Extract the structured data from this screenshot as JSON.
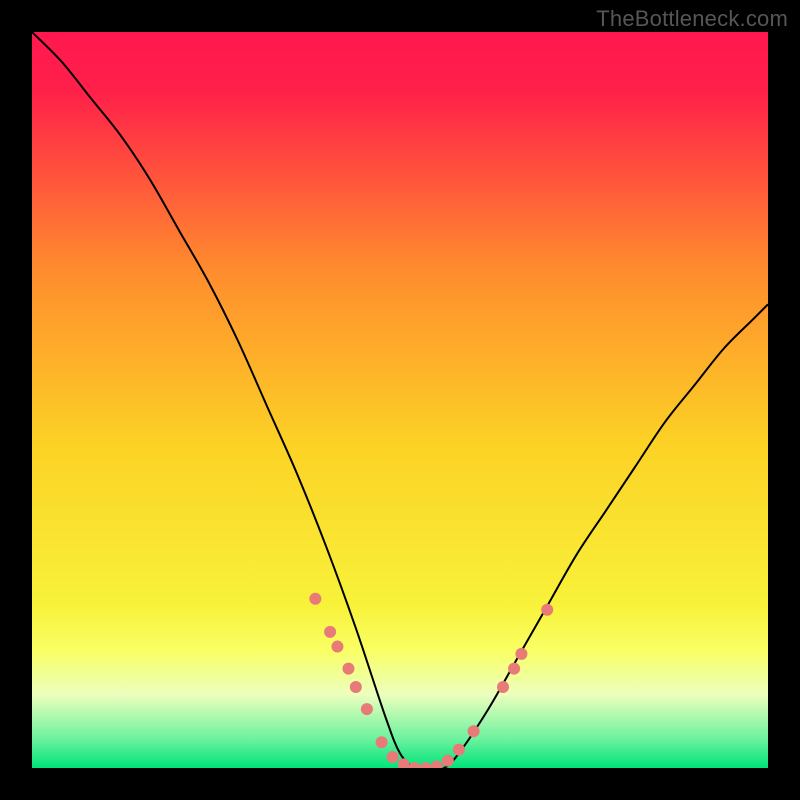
{
  "watermark": "TheBottleneck.com",
  "chart_data": {
    "type": "line",
    "title": "",
    "xlabel": "",
    "ylabel": "",
    "xlim": [
      0,
      100
    ],
    "ylim": [
      0,
      100
    ],
    "grid": false,
    "legend": false,
    "background": {
      "style": "vertical-gradient",
      "stops": [
        {
          "offset": 0.0,
          "color": "#ff1850"
        },
        {
          "offset": 0.08,
          "color": "#ff2049"
        },
        {
          "offset": 0.32,
          "color": "#ff8b2e"
        },
        {
          "offset": 0.56,
          "color": "#fcd225"
        },
        {
          "offset": 0.78,
          "color": "#f8f23a"
        },
        {
          "offset": 0.84,
          "color": "#f9ff64"
        },
        {
          "offset": 0.9,
          "color": "#ecffbd"
        },
        {
          "offset": 0.96,
          "color": "#6df29f"
        },
        {
          "offset": 1.0,
          "color": "#00e47a"
        }
      ]
    },
    "series": [
      {
        "name": "curve",
        "color": "#000000",
        "stroke_width": 2,
        "x": [
          0,
          4,
          8,
          12,
          16,
          20,
          24,
          28,
          32,
          36,
          40,
          44,
          48,
          50,
          52,
          54,
          56,
          58,
          62,
          66,
          70,
          74,
          78,
          82,
          86,
          90,
          94,
          98,
          100
        ],
        "y": [
          100,
          96,
          91,
          86,
          80,
          73,
          66,
          58,
          49,
          40,
          30,
          19,
          7,
          2,
          0,
          0,
          0,
          2,
          8,
          15,
          22,
          29,
          35,
          41,
          47,
          52,
          57,
          61,
          63
        ]
      }
    ],
    "markers": {
      "name": "dots",
      "color": "#e87a78",
      "radius": 6,
      "points": [
        {
          "x": 38.5,
          "y": 23.0
        },
        {
          "x": 40.5,
          "y": 18.5
        },
        {
          "x": 41.5,
          "y": 16.5
        },
        {
          "x": 43.0,
          "y": 13.5
        },
        {
          "x": 44.0,
          "y": 11.0
        },
        {
          "x": 45.5,
          "y": 8.0
        },
        {
          "x": 47.5,
          "y": 3.5
        },
        {
          "x": 49.0,
          "y": 1.5
        },
        {
          "x": 50.5,
          "y": 0.5
        },
        {
          "x": 52.0,
          "y": 0.0
        },
        {
          "x": 53.5,
          "y": 0.0
        },
        {
          "x": 55.0,
          "y": 0.2
        },
        {
          "x": 56.5,
          "y": 1.0
        },
        {
          "x": 58.0,
          "y": 2.5
        },
        {
          "x": 60.0,
          "y": 5.0
        },
        {
          "x": 64.0,
          "y": 11.0
        },
        {
          "x": 65.5,
          "y": 13.5
        },
        {
          "x": 66.5,
          "y": 15.5
        },
        {
          "x": 70.0,
          "y": 21.5
        }
      ]
    }
  }
}
